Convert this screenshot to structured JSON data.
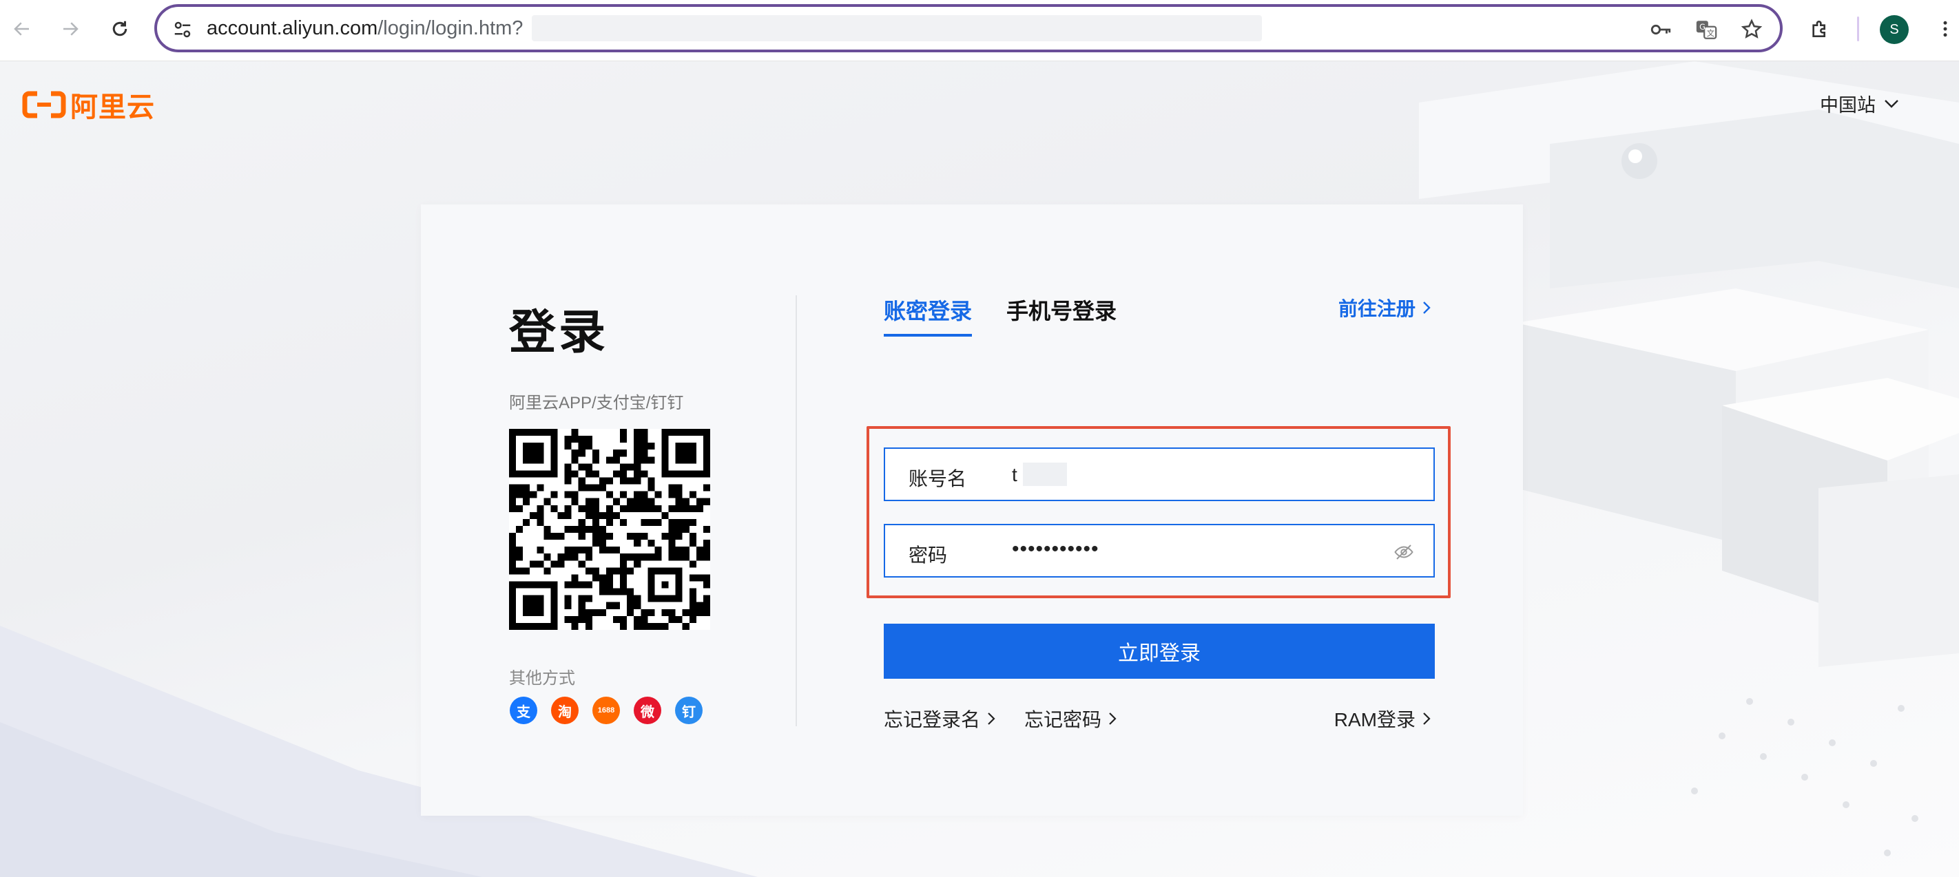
{
  "browser": {
    "url_host": "account.aliyun.com",
    "url_path": "/login/login.htm?",
    "avatar_letter": "S"
  },
  "header": {
    "logo_text": "阿里云",
    "region": "中国站"
  },
  "card": {
    "title": "登录",
    "qr_hint": "阿里云APP/支付宝/钉钉",
    "other_methods_label": "其他方式",
    "socials": [
      {
        "name": "alipay-icon",
        "glyph": "支",
        "color": "#1677ff"
      },
      {
        "name": "taobao-icon",
        "glyph": "淘",
        "color": "#ff5000"
      },
      {
        "name": "1688-icon",
        "glyph": "1688",
        "color": "#ff6a00"
      },
      {
        "name": "weibo-icon",
        "glyph": "微",
        "color": "#e6162d"
      },
      {
        "name": "dingtalk-icon",
        "glyph": "钉",
        "color": "#2a8cf0"
      }
    ],
    "tabs": [
      {
        "label": "账密登录",
        "active": true
      },
      {
        "label": "手机号登录",
        "active": false
      }
    ],
    "register_link": "前往注册",
    "account_field": {
      "label": "账号名",
      "value": "t"
    },
    "password_field": {
      "label": "密码",
      "value": "•••••••••••"
    },
    "login_button": "立即登录",
    "forgot_username": "忘记登录名",
    "forgot_password": "忘记密码",
    "ram_login": "RAM登录"
  },
  "colors": {
    "accent": "#1669e6",
    "brand": "#ff6a00",
    "highlight_box": "#e4513a"
  }
}
